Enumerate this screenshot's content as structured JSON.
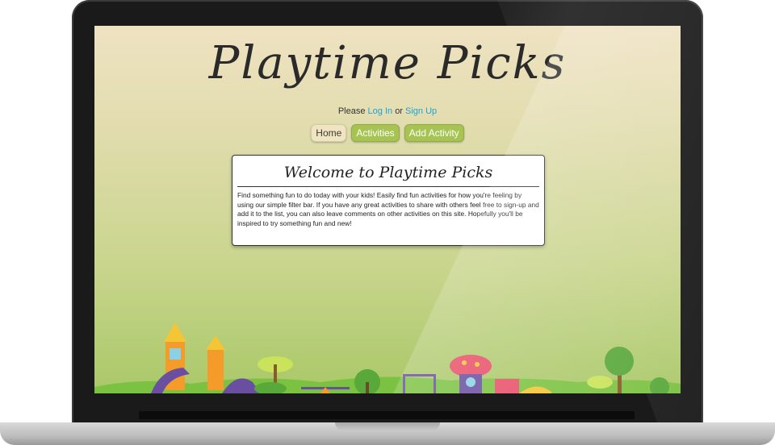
{
  "site": {
    "title": "Playtime Picks",
    "auth_prefix": "Please",
    "login_label": "Log In",
    "auth_or": "or",
    "signup_label": "Sign Up"
  },
  "nav": {
    "home": "Home",
    "activities": "Activities",
    "add_activity": "Add Activity"
  },
  "welcome": {
    "title": "Welcome to Playtime Picks",
    "body": "Find something fun to do today with your kids! Easily find fun activities for how you're feeling by using our simple filter bar. If you have any great activities to share with others feel free to sign-up and add it to the list, you can also leave comments on other activities on this site. Hopefully you'll be inspired to try something fun and new!"
  },
  "colors": {
    "link": "#1aa3d9",
    "nav_green": "#a7c453",
    "home_bg": "#f1e4c0"
  }
}
